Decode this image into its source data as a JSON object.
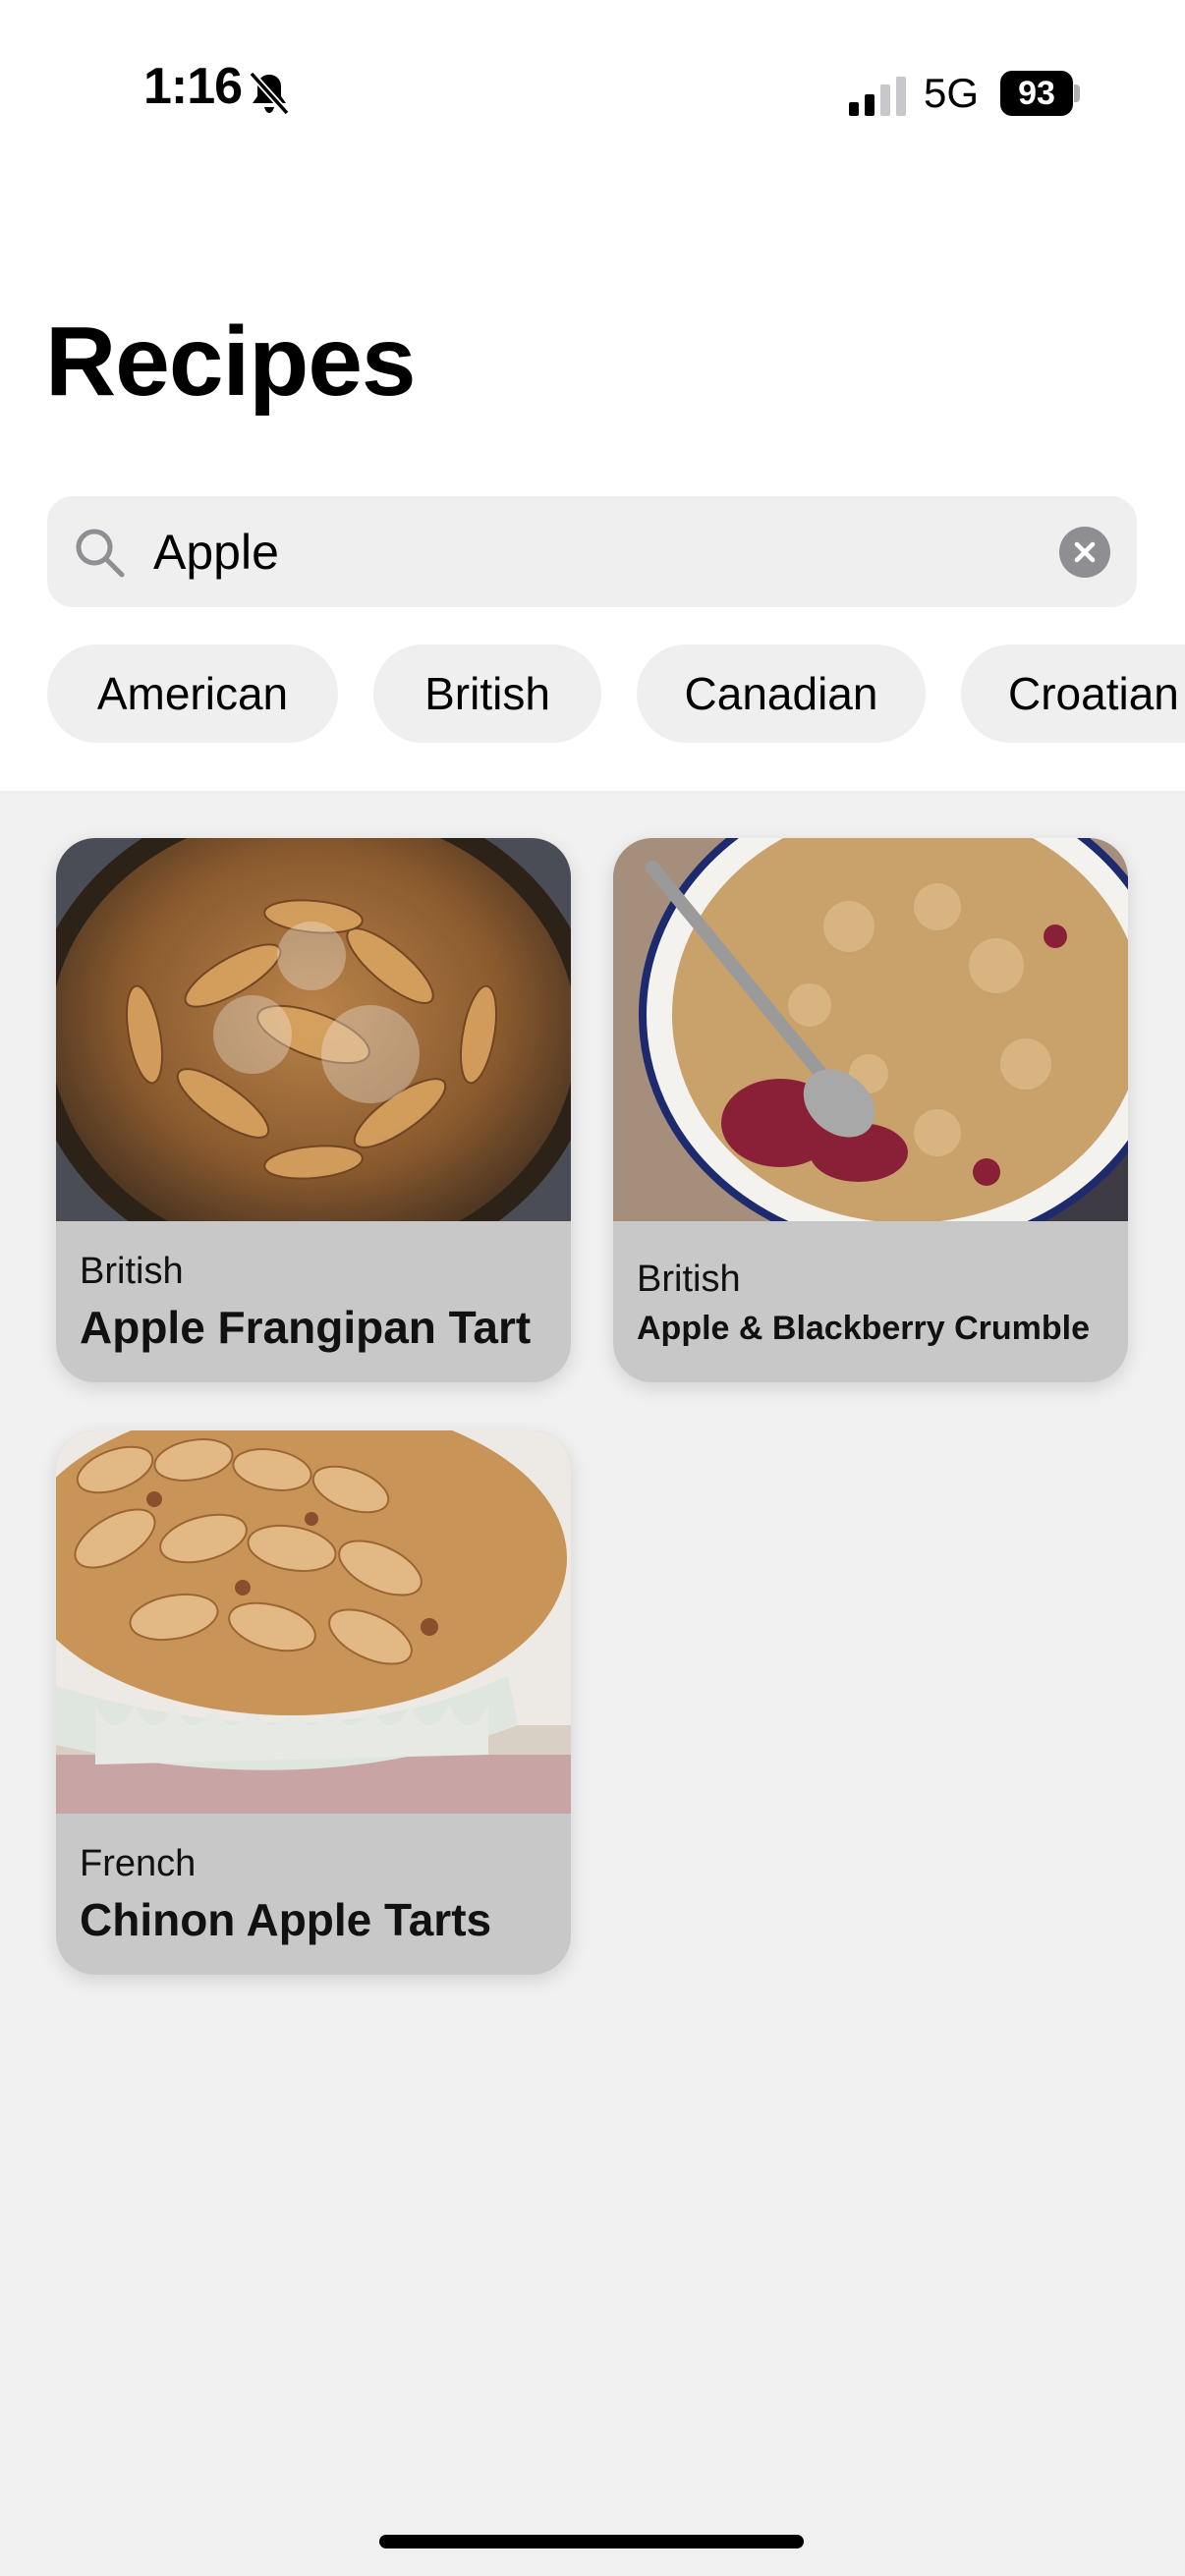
{
  "status_bar": {
    "time": "1:16",
    "network": "5G",
    "battery": "93"
  },
  "page": {
    "title": "Recipes"
  },
  "search": {
    "value": "Apple",
    "icon": "search-icon",
    "clear_icon": "clear-icon"
  },
  "categories": [
    "American",
    "British",
    "Canadian",
    "Croatian"
  ],
  "recipes": [
    {
      "cuisine": "British",
      "name": "Apple Frangipan Tart",
      "image": "apple-tart-photo"
    },
    {
      "cuisine": "British",
      "name": "Apple & Blackberry Crumble",
      "image": "crumble-photo"
    },
    {
      "cuisine": "French",
      "name": "Chinon Apple Tarts",
      "image": "chinon-tart-photo"
    }
  ],
  "colors": {
    "background": "#f0f0f0",
    "header_background": "#ffffff",
    "card_footer": "#c8c8c8",
    "chip_background": "#efefef"
  }
}
